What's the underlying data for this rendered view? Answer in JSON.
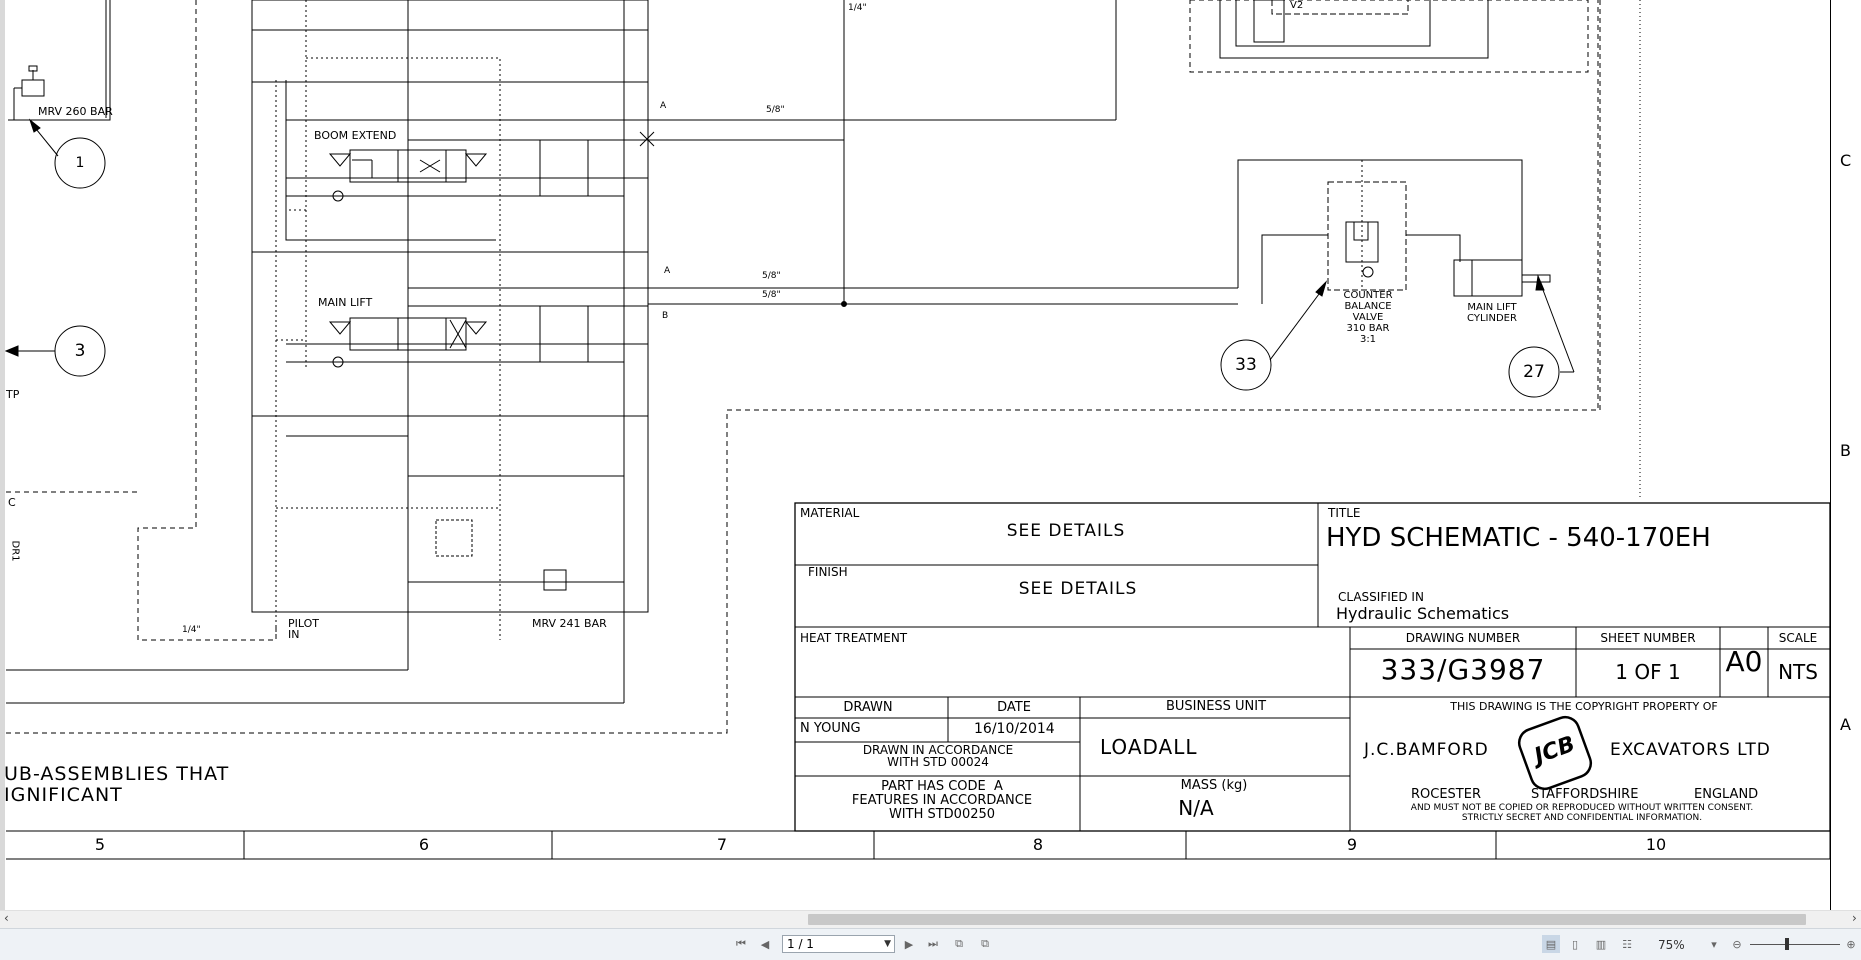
{
  "schematic": {
    "labels": {
      "mrv260": "MRV 260 BAR",
      "boom_extend": "BOOM EXTEND",
      "main_lift": "MAIN LIFT",
      "pilot_in": "PILOT\nIN",
      "mrv241": "MRV 241 BAR",
      "port_a1": "A",
      "port_a2": "A",
      "port_b": "B",
      "pipe_58_1": "5/8\"",
      "pipe_58_2": "5/8\"",
      "pipe_58_3": "5/8\"",
      "pipe_14_top": "1/4\"",
      "pipe_14_bottom": "1/4\"",
      "v2": "V2",
      "tp": "TP",
      "c_left": "C",
      "dr1": "DR1",
      "cbv": "COUNTER\nBALANCE\nVALVE\n310 BAR\n3:1",
      "cyl": "MAIN LIFT\nCYLINDER"
    },
    "balloons": [
      "1",
      "3",
      "33",
      "27"
    ],
    "note_line1": "UB-ASSEMBLIES THAT",
    "note_line2": "IGNIFICANT",
    "zones_bottom": [
      "5",
      "6",
      "7",
      "8",
      "9",
      "10"
    ],
    "zones_right": [
      "C",
      "B",
      "A"
    ]
  },
  "title_block": {
    "material_label": "MATERIAL",
    "material_value": "SEE DETAILS",
    "finish_label": "FINISH",
    "finish_value": "SEE DETAILS",
    "heat_label": "HEAT TREATMENT",
    "title_label": "TITLE",
    "title_value": "HYD SCHEMATIC - 540-170EH",
    "classified_label": "CLASSIFIED IN",
    "classified_value": "Hydraulic Schematics",
    "drawing_number_label": "DRAWING NUMBER",
    "drawing_number": "333/G3987",
    "sheet_number_label": "SHEET NUMBER",
    "sheet_number": "1 OF 1",
    "size": "A0",
    "scale_label": "SCALE",
    "scale": "NTS",
    "drawn_label": "DRAWN",
    "drawn_by": "N YOUNG",
    "date_label": "DATE",
    "date": "16/10/2014",
    "business_unit_label": "BUSINESS UNIT",
    "business_unit": "LOADALL",
    "accordance": "DRAWN IN ACCORDANCE\nWITH STD 00024",
    "part_code": "PART HAS CODE  A\nFEATURES IN ACCORDANCE\nWITH STD00250",
    "mass_label": "MASS (kg)",
    "mass": "N/A",
    "copyright": "THIS DRAWING IS THE COPYRIGHT PROPERTY OF",
    "company_left": "J.C.BAMFORD",
    "company_right": "EXCAVATORS LTD",
    "logo_text": "JCB",
    "location_1": "ROCESTER",
    "location_2": "STAFFORDSHIRE",
    "location_3": "ENGLAND",
    "notice": "AND MUST NOT BE COPIED OR REPRODUCED WITHOUT WRITTEN CONSENT.\nSTRICTLY SECRET AND CONFIDENTIAL INFORMATION."
  },
  "viewer": {
    "page_field": "1 / 1",
    "zoom": "75%",
    "icons": [
      "first-page-icon",
      "prev-page-icon",
      "next-page-icon",
      "last-page-icon",
      "prev-view-icon",
      "next-view-icon",
      "single-page-icon",
      "continuous-icon",
      "facing-icon",
      "continuous-facing-icon",
      "zoom-out-icon",
      "zoom-in-icon"
    ]
  }
}
